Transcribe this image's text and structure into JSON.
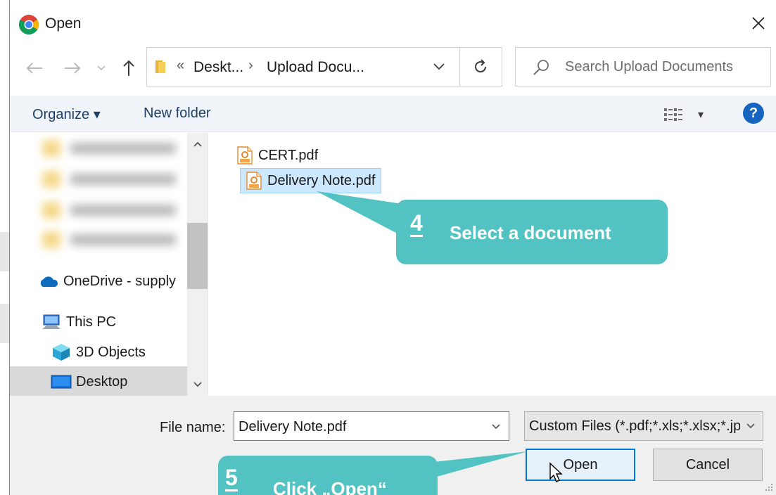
{
  "window": {
    "title": "Open",
    "close_glyph": "✕"
  },
  "nav": {
    "back_glyph": "←",
    "forward_glyph": "→",
    "recent_glyph": "⌄",
    "up_glyph": "↑"
  },
  "address_bar": {
    "overflow_glyph": "«",
    "segments": [
      "Deskt...",
      "Upload Docu..."
    ],
    "separator": "›",
    "dropdown_glyph": "⌄",
    "refresh_glyph": "↻"
  },
  "search": {
    "placeholder": "Search Upload Documents"
  },
  "toolbar": {
    "organize_label": "Organize ▾",
    "new_folder_label": "New folder",
    "view_dropdown_glyph": "▾",
    "help_label": "?"
  },
  "nav_pane": {
    "items": [
      {
        "label": "OneDrive - supply",
        "icon": "onedrive-cloud-icon"
      },
      {
        "label": "This PC",
        "icon": "computer-icon"
      },
      {
        "label": "3D Objects",
        "icon": "3d-objects-icon"
      },
      {
        "label": "Desktop",
        "icon": "desktop-icon",
        "selected": true
      }
    ],
    "scroll_up_glyph": "⌃",
    "scroll_down_glyph": "⌄"
  },
  "files": [
    {
      "name": "CERT.pdf",
      "icon": "pdf-file-icon",
      "selected": false
    },
    {
      "name": "Delivery Note.pdf",
      "icon": "pdf-file-icon",
      "selected": true
    }
  ],
  "bottom": {
    "file_name_label": "File name:",
    "file_name_value": "Delivery Note.pdf",
    "file_type_value": "Custom Files (*.pdf;*.xls;*.xlsx;*.jpg)",
    "dropdown_glyph": "⌄",
    "open_label": "Open",
    "cancel_label": "Cancel"
  },
  "callouts": [
    {
      "number": "4",
      "text": "Select a document"
    },
    {
      "number": "5",
      "text": "Click „Open“"
    }
  ],
  "colors": {
    "callout": "#53c2c2",
    "accent": "#0078d7",
    "toolbar_bg": "#f0f4f9",
    "selection": "#cce8ff"
  }
}
